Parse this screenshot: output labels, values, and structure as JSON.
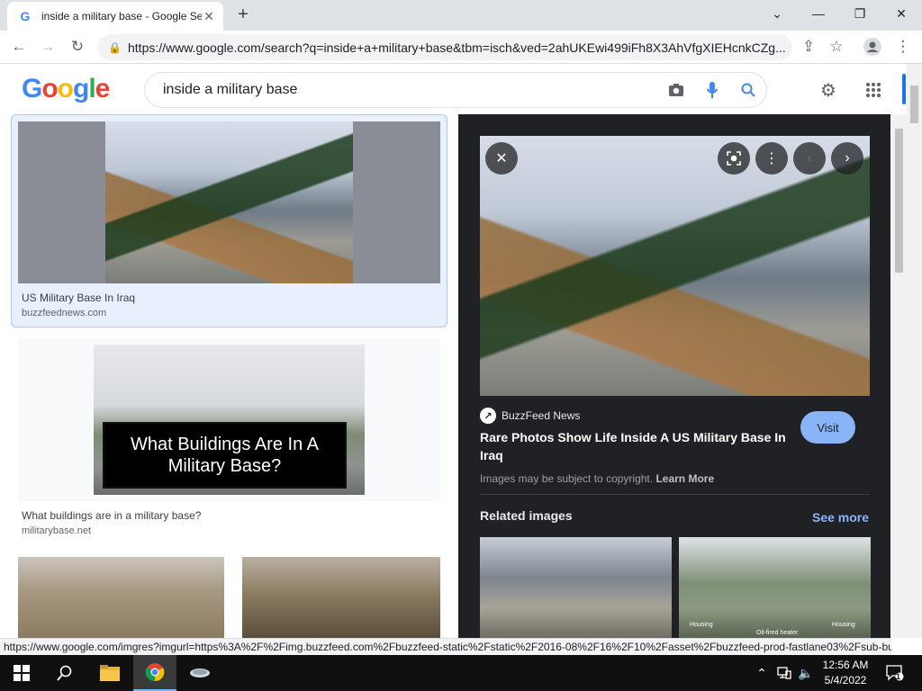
{
  "browser": {
    "tab_title": "inside a military base - Google Se",
    "tab_favicon": "G",
    "new_tab": "+",
    "url": "https://www.google.com/search?q=inside+a+military+base&tbm=isch&ved=2ahUKEwi499iFh8X3AhVfgXIEHcnkCZg..."
  },
  "google": {
    "logo_letters": [
      "G",
      "o",
      "o",
      "g",
      "l",
      "e"
    ],
    "logo_colors": [
      "#4285f4",
      "#ea4335",
      "#fbbc05",
      "#4285f4",
      "#34a853",
      "#ea4335"
    ],
    "query": "inside a military base"
  },
  "results": [
    {
      "caption": "US Military Base In Iraq",
      "domain": "buzzfeednews.com"
    },
    {
      "caption": "What buildings are in a military base?",
      "domain": "militarybase.net",
      "overlay": "What Buildings Are In A Military Base?"
    }
  ],
  "preview": {
    "source_name": "BuzzFeed News",
    "title": "Rare Photos Show Life Inside A US Military Base In Iraq",
    "visit_label": "Visit",
    "copyright_text": "Images may be subject to copyright.",
    "learn_more": "Learn More",
    "related_heading": "Related images",
    "see_more": "See more",
    "related_labels": [
      "Housing",
      "Oil-fired heater",
      "Housing"
    ]
  },
  "status_url": "https://www.google.com/imgres?imgurl=https%3A%2F%2Fimg.buzzfeed.com%2Fbuzzfeed-static%2Fstatic%2F2016-08%2F16%2F10%2Fasset%2Fbuzzfeed-prod-fastlane03%2Fsub-buz...",
  "taskbar": {
    "time": "12:56 AM",
    "date": "5/4/2022",
    "notifications": "1"
  },
  "colors": {
    "accent": "#1a73e8",
    "panel_bg": "#202124",
    "visit_bg": "#8ab4f8"
  }
}
